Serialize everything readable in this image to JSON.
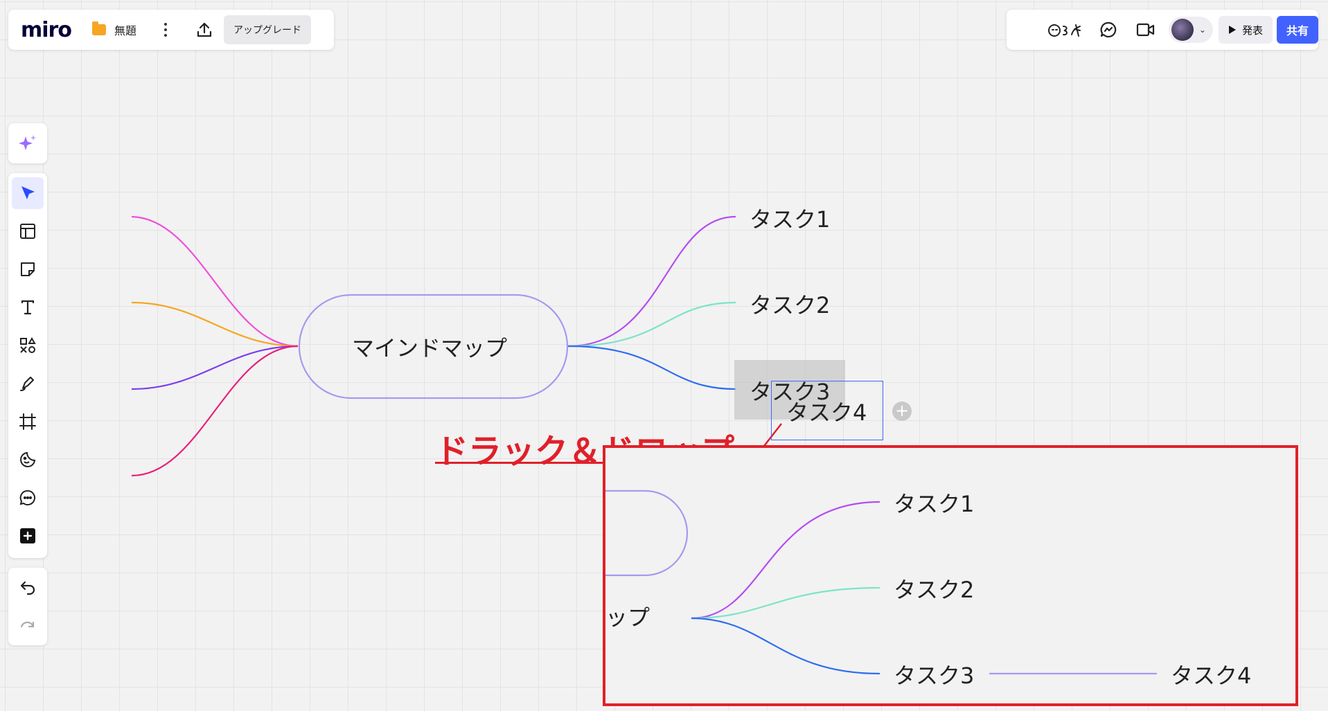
{
  "app": {
    "logo": "miro",
    "board_title": "無題",
    "upgrade_label": "アップグレード"
  },
  "topbar_right": {
    "reactions_label": "ଓЗ৯",
    "present_label": "発表",
    "share_label": "共有"
  },
  "toolbar": {
    "tools": [
      "select",
      "templates",
      "sticky-note",
      "text",
      "shapes",
      "pen",
      "frame",
      "stickers",
      "comment",
      "more"
    ],
    "active_tool": "select"
  },
  "mindmap": {
    "center": "マインドマップ",
    "tasks": [
      "タスク1",
      "タスク2",
      "タスク3"
    ],
    "dragging": "タスク4",
    "branch_colors": {
      "task1": "#b54cf0",
      "task2": "#7de3c9",
      "task3": "#2f6df0",
      "left": [
        "#f050d8",
        "#f5a623",
        "#7a3ff0",
        "#e8207a"
      ]
    }
  },
  "annotation": {
    "label": "ドラック＆ドロップ",
    "color": "#e0202a"
  },
  "result": {
    "center_fragment": "ップ",
    "tasks": [
      "タスク1",
      "タスク2",
      "タスク3"
    ],
    "child": "タスク4"
  }
}
